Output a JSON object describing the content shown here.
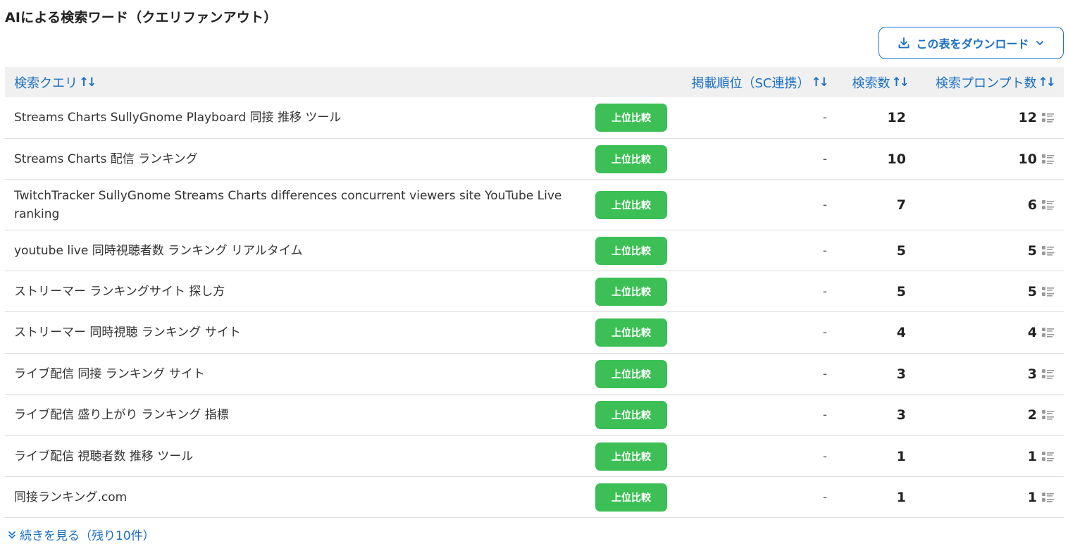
{
  "section_title": "AIによる検索ワード（クエリファンアウト）",
  "download_button": {
    "label": "この表をダウンロード",
    "icon": "download-icon"
  },
  "columns": {
    "query": "検索クエリ",
    "rank": "掲載順位（SC連携）",
    "search_count": "検索数",
    "prompt_count": "検索プロンプト数",
    "sort_glyph": "↑↓"
  },
  "compare_label": "上位比較",
  "rows": [
    {
      "query": "Streams Charts SullyGnome Playboard 同接 推移 ツール",
      "rank": "-",
      "search_count": "12",
      "prompt_count": "12"
    },
    {
      "query": "Streams Charts 配信 ランキング",
      "rank": "-",
      "search_count": "10",
      "prompt_count": "10"
    },
    {
      "query": "TwitchTracker SullyGnome Streams Charts differences concurrent viewers site YouTube Live ranking",
      "rank": "-",
      "search_count": "7",
      "prompt_count": "6"
    },
    {
      "query": "youtube live 同時視聴者数 ランキング リアルタイム",
      "rank": "-",
      "search_count": "5",
      "prompt_count": "5"
    },
    {
      "query": "ストリーマー ランキングサイト 探し方",
      "rank": "-",
      "search_count": "5",
      "prompt_count": "5"
    },
    {
      "query": "ストリーマー 同時視聴 ランキング サイト",
      "rank": "-",
      "search_count": "4",
      "prompt_count": "4"
    },
    {
      "query": "ライブ配信 同接 ランキング サイト",
      "rank": "-",
      "search_count": "3",
      "prompt_count": "3"
    },
    {
      "query": "ライブ配信 盛り上がり ランキング 指標",
      "rank": "-",
      "search_count": "3",
      "prompt_count": "2"
    },
    {
      "query": "ライブ配信 視聴者数 推移 ツール",
      "rank": "-",
      "search_count": "1",
      "prompt_count": "1"
    },
    {
      "query": "同接ランキング.com",
      "rank": "-",
      "search_count": "1",
      "prompt_count": "1"
    }
  ],
  "show_more": {
    "label": "続きを見る（残り10件）",
    "icon": "double-chevron-down-icon"
  },
  "colors": {
    "accent": "#1a6fc4",
    "button_green": "#3cbf55",
    "header_bg": "#f0f0f0"
  }
}
